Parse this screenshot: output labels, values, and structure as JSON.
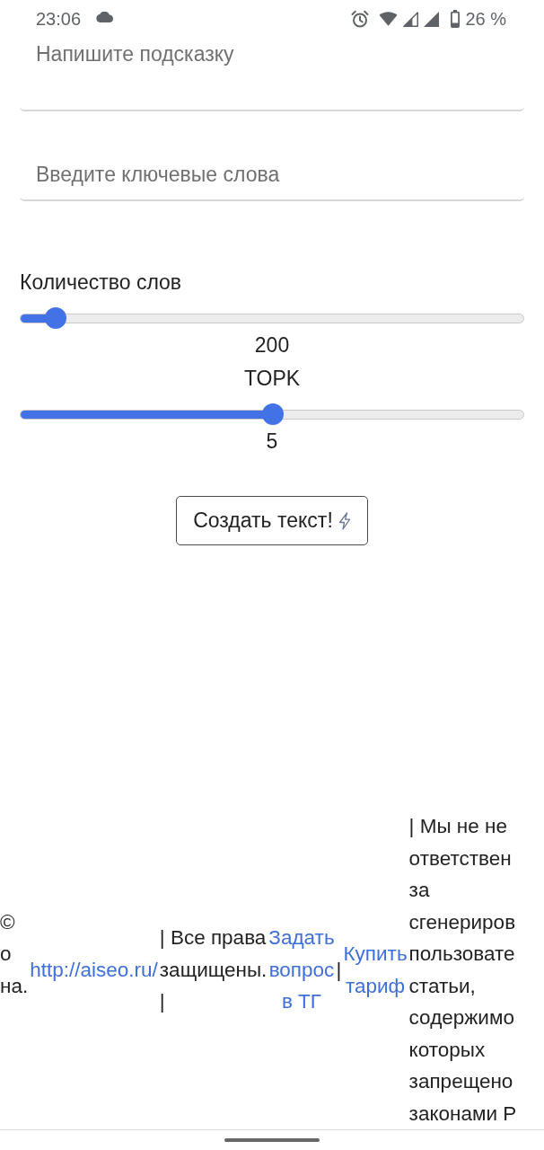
{
  "status_bar": {
    "time": "23:06",
    "battery": "26 %"
  },
  "prompt_field": {
    "placeholder": "Напишите подсказку"
  },
  "keywords_field": {
    "placeholder": "Введите ключевые слова"
  },
  "word_count_label": "Количество слов",
  "sliders": [
    {
      "level": 0.071,
      "reading": "200"
    },
    {
      "label": "TOPK",
      "level": 0.502,
      "reading": "5"
    }
  ],
  "generate_button": {
    "label": "Создать текст!"
  },
  "footer": {
    "items": [
      {
        "kind": "text",
        "text": "©\nо\nна."
      },
      {
        "kind": "link",
        "text": "http://aiseo.ru/"
      },
      {
        "kind": "text",
        "text": "| Все права\nзащищены.\n|"
      },
      {
        "kind": "link",
        "text": "Задать\nвопрос\nв ТГ"
      },
      {
        "kind": "text",
        "text": "|"
      },
      {
        "kind": "link",
        "text": "Купить\nтариф"
      },
      {
        "kind": "text",
        "text": "| Мы не не\nответствен\nза\nсгенериров\nпользовате\nстатьи,\nсодержимо\nкоторых\nзапрещено\nзаконами Р"
      }
    ]
  }
}
